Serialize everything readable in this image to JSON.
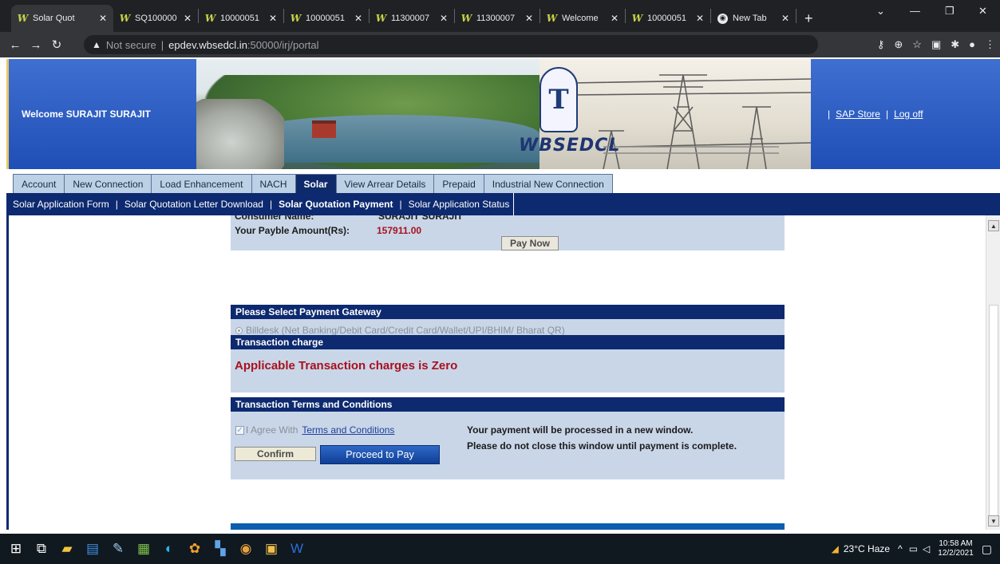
{
  "browser": {
    "tabs": [
      {
        "label": "Solar Quot",
        "active": true
      },
      {
        "label": "SQ100000",
        "active": false
      },
      {
        "label": "10000051",
        "active": false
      },
      {
        "label": "10000051",
        "active": false
      },
      {
        "label": "11300007",
        "active": false
      },
      {
        "label": "11300007",
        "active": false
      },
      {
        "label": "Welcome",
        "active": false
      },
      {
        "label": "10000051",
        "active": false
      },
      {
        "label": "New Tab",
        "active": false
      }
    ],
    "new_tab_label": "+",
    "security_label": "Not secure",
    "url_host": "epdev.wbsedcl.in",
    "url_rest": ":50000/irj/portal"
  },
  "header": {
    "welcome_text": "Welcome SURAJIT SURAJIT",
    "brand_text": "WBSEDCL",
    "logo_glyph": "T",
    "link_sap_store": "SAP Store",
    "link_logoff": "Log off",
    "link_separator": "|"
  },
  "nav": {
    "tabs": [
      {
        "label": "Account",
        "selected": false
      },
      {
        "label": "New Connection",
        "selected": false
      },
      {
        "label": "Load Enhancement",
        "selected": false
      },
      {
        "label": "NACH",
        "selected": false
      },
      {
        "label": "Solar",
        "selected": true
      },
      {
        "label": "View Arrear Details",
        "selected": false
      },
      {
        "label": "Prepaid",
        "selected": false
      },
      {
        "label": "Industrial New Connection",
        "selected": false
      }
    ],
    "subitems": [
      {
        "label": "Solar Application Form",
        "selected": false
      },
      {
        "label": "Solar Quotation Letter Download",
        "selected": false
      },
      {
        "label": "Solar Quotation Payment",
        "selected": true
      },
      {
        "label": "Solar Application Status",
        "selected": false
      }
    ],
    "sub_separator": "|"
  },
  "payment": {
    "consumer_name_label": "Consumer Name:",
    "consumer_name_value": "SURAJIT SURAJIT",
    "payable_label": "Your Payble Amount(Rs):",
    "payable_value": "157911.00",
    "pay_now_label": "Pay Now"
  },
  "gateway": {
    "title": "Please Select Payment Gateway",
    "option_label": "Billdesk (Net Banking/Debit Card/Credit Card/Wallet/UPI/BHIM/ Bharat QR)"
  },
  "transaction": {
    "title": "Transaction charge",
    "message": "Applicable Transaction charges is Zero"
  },
  "terms": {
    "title": "Transaction Terms and Conditions",
    "agree_label": "I Agree With",
    "terms_link": "Terms and Conditions",
    "confirm_label": "Confirm",
    "proceed_label": "Proceed to Pay",
    "note_line1": "Your payment will be processed in a new window.",
    "note_line2": "Please do not close this window until payment is complete."
  },
  "taskbar": {
    "weather": "23°C  Haze",
    "time": "10:58 AM",
    "date": "12/2/2021"
  },
  "colors": {
    "nav_dark": "#0d2a70",
    "panel_bg": "#c9d6e8",
    "amount_red": "#a8111e",
    "header_blue": "#2f5fc4"
  }
}
